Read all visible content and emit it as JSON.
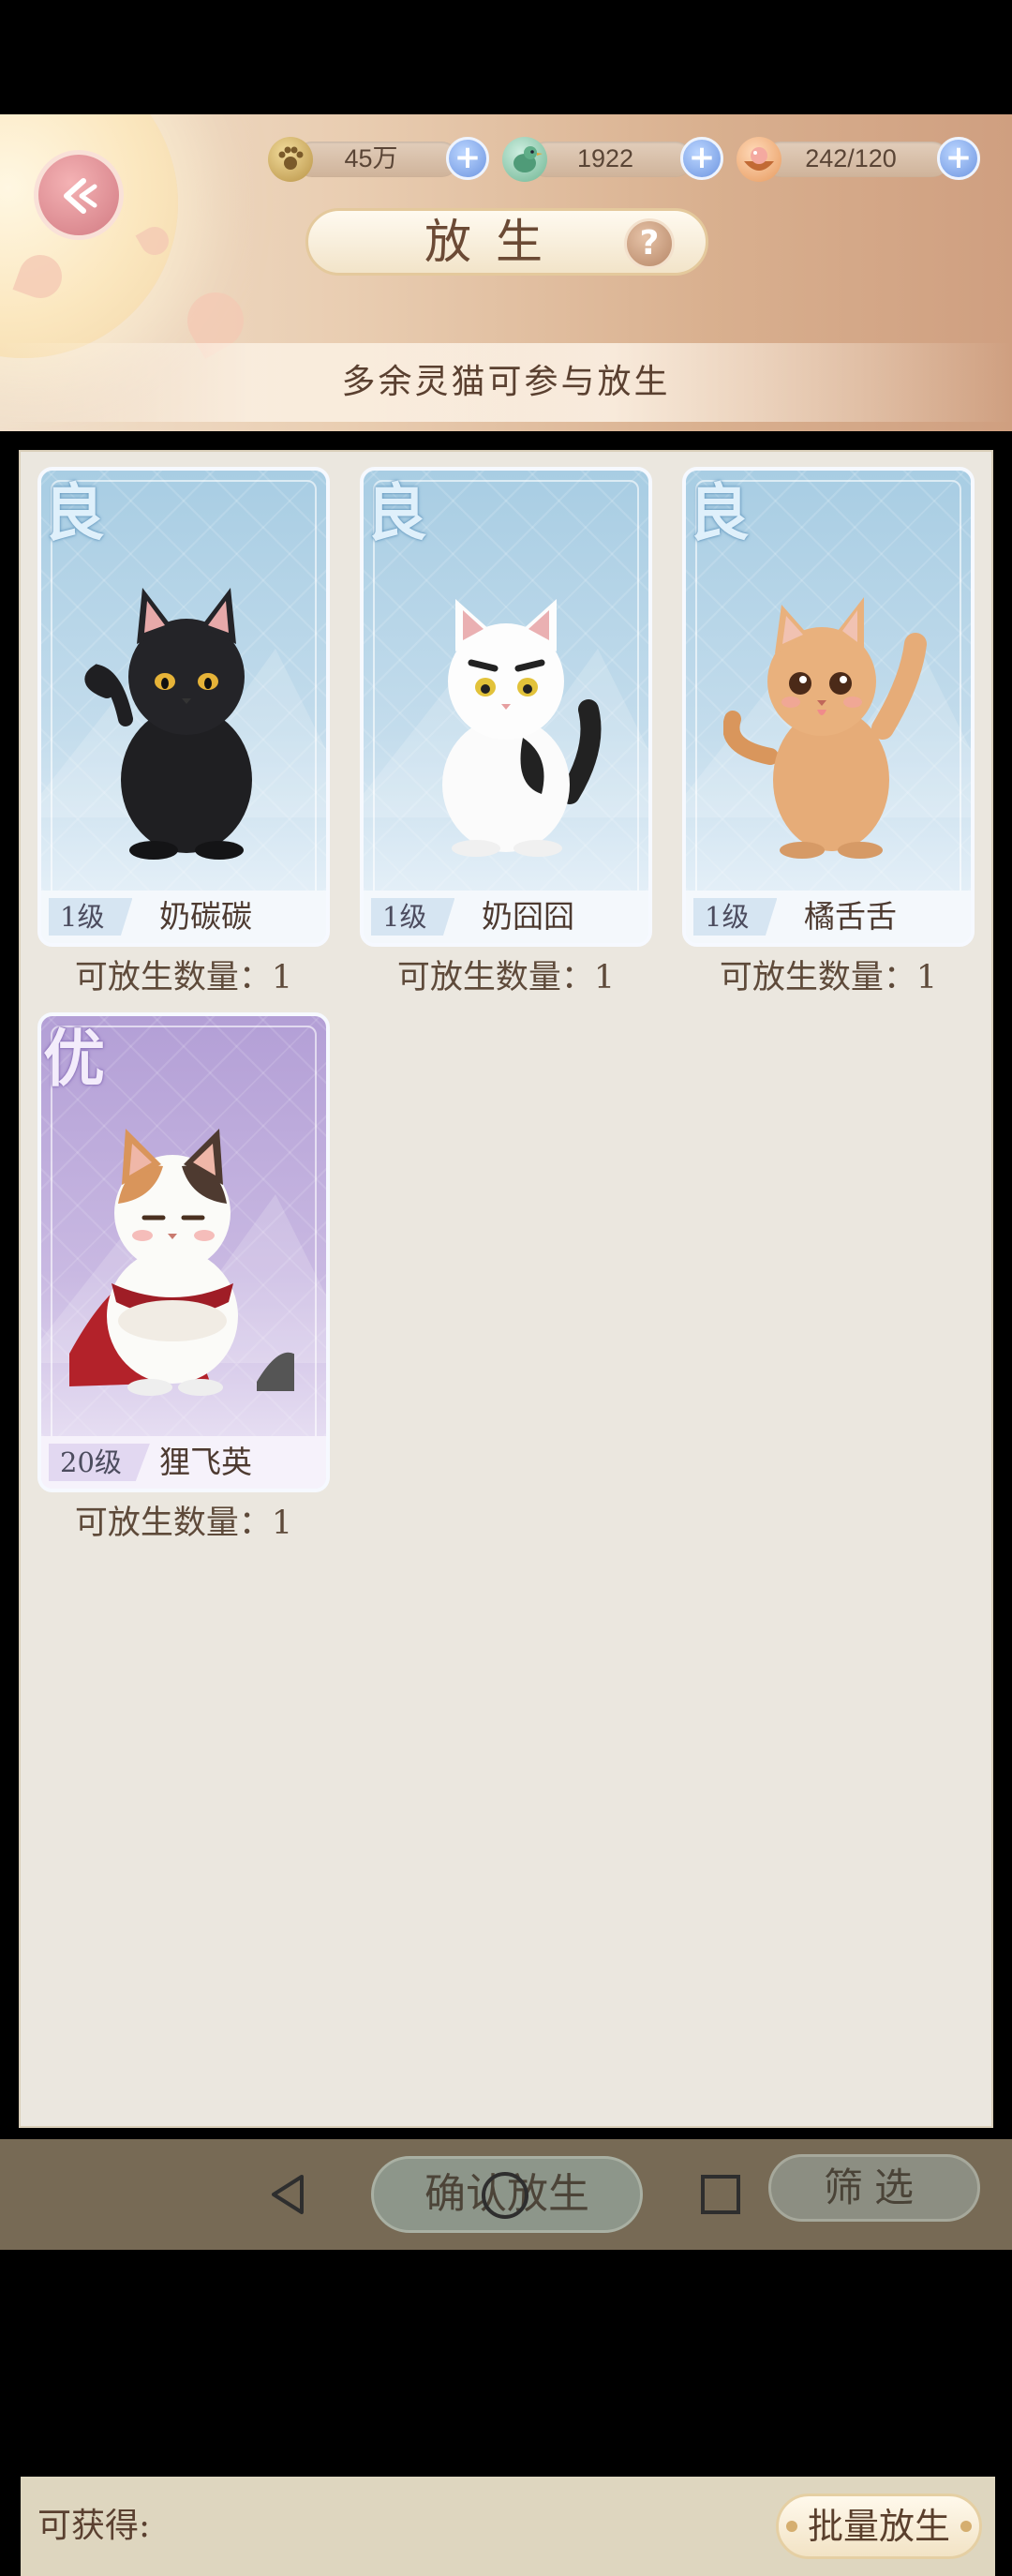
{
  "header": {
    "title": "放生",
    "help_icon_glyph": "?",
    "subtitle": "多余灵猫可参与放生",
    "resources": [
      {
        "icon": "paw-coin-icon",
        "value": "45万"
      },
      {
        "icon": "green-bird-icon",
        "value": "1922"
      },
      {
        "icon": "food-bowl-icon",
        "value": "242/120"
      }
    ]
  },
  "cats": [
    {
      "rarity": "良",
      "level": "1级",
      "name": "奶碳碳",
      "count_label": "可放生数量：1",
      "fur": "black"
    },
    {
      "rarity": "良",
      "level": "1级",
      "name": "奶囧囧",
      "count_label": "可放生数量：1",
      "fur": "white-black"
    },
    {
      "rarity": "良",
      "level": "1级",
      "name": "橘舌舌",
      "count_label": "可放生数量：1",
      "fur": "orange-tabby"
    },
    {
      "rarity": "优",
      "level": "20级",
      "name": "狸飞英",
      "count_label": "可放生数量：1",
      "fur": "calico"
    }
  ],
  "bottom": {
    "obtain_label": "可获得:",
    "batch_release_label": "批量放生"
  },
  "footer": {
    "confirm_label": "确认放生",
    "filter_label": "筛选"
  },
  "colors": {
    "good_card": "#a8cde3",
    "excellent_card": "#b39fd6",
    "panel": "#ebe7df",
    "plus_button": "#6d95e0"
  }
}
